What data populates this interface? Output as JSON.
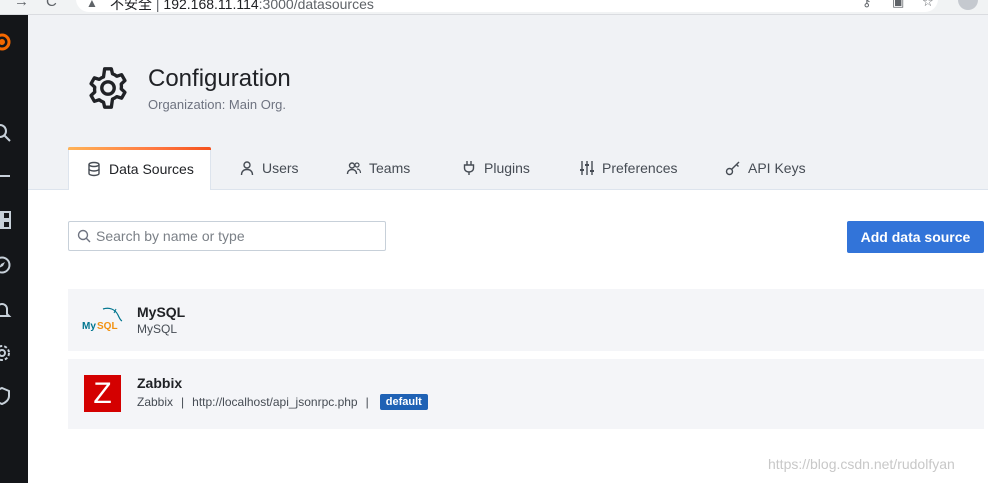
{
  "browser": {
    "security_label": "不安全",
    "url_host": "192.168.11.114",
    "url_rest": ":3000/datasources"
  },
  "sidemenu": {
    "icons": [
      "grafana-logo-icon",
      "search-icon",
      "add-icon",
      "dashboards-icon",
      "explore-icon",
      "alerting-icon",
      "gear-icon",
      "shield-icon"
    ]
  },
  "header": {
    "title": "Configuration",
    "subtitle": "Organization: Main Org."
  },
  "tabs": [
    {
      "label": "Data Sources",
      "icon": "database-icon",
      "active": true
    },
    {
      "label": "Users",
      "icon": "user-icon",
      "active": false
    },
    {
      "label": "Teams",
      "icon": "users-icon",
      "active": false
    },
    {
      "label": "Plugins",
      "icon": "plug-icon",
      "active": false
    },
    {
      "label": "Preferences",
      "icon": "sliders-icon",
      "active": false
    },
    {
      "label": "API Keys",
      "icon": "key-icon",
      "active": false
    }
  ],
  "search": {
    "placeholder": "Search by name or type",
    "value": ""
  },
  "actions": {
    "add_label": "Add data source"
  },
  "datasources": [
    {
      "name": "MySQL",
      "type": "MySQL",
      "url": "",
      "default": false,
      "logo": "mysql-logo"
    },
    {
      "name": "Zabbix",
      "type": "Zabbix",
      "url": "http://localhost/api_jsonrpc.php",
      "default": true,
      "logo": "zabbix-logo",
      "logo_letter": "Z"
    }
  ],
  "badge_default_label": "default",
  "separator": "|",
  "watermark": "https://blog.csdn.net/rudolfyan",
  "colors": {
    "primary_button": "#3274d9",
    "badge": "#1f62b5",
    "tab_accent": "#ff7941",
    "sidemenu": "#141619"
  }
}
